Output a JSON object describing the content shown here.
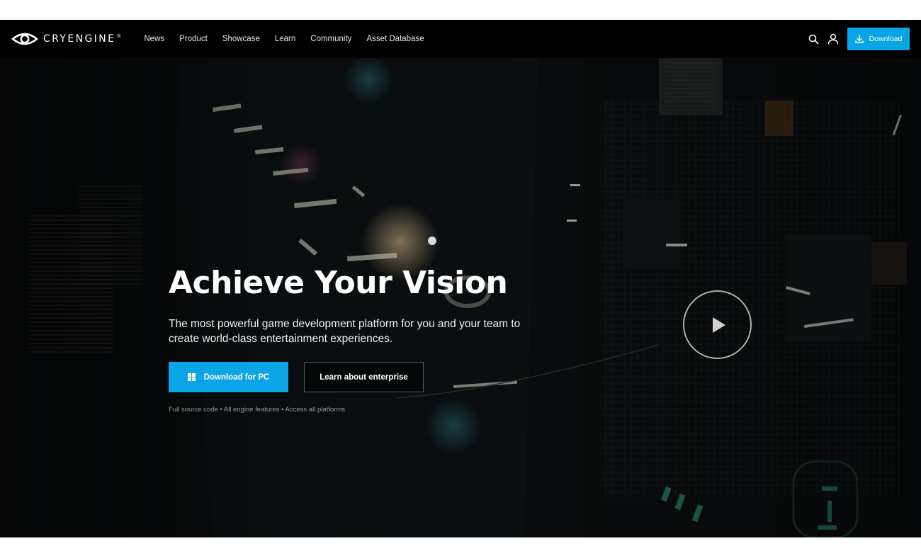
{
  "brand": {
    "name": "CRYENGINE",
    "registered_mark": "®"
  },
  "nav": {
    "links": [
      "News",
      "Product",
      "Showcase",
      "Learn",
      "Community",
      "Asset Database"
    ],
    "download_label": "Download"
  },
  "hero": {
    "title": "Achieve Your Vision",
    "subtitle": "The most powerful game development platform for you and your team to create world-class entertainment experiences.",
    "primary_button": "Download for PC",
    "secondary_button": "Learn about enterprise",
    "note": "Full source code • All engine features • Access all platforms"
  },
  "icons": {
    "logo": "eye-logo-icon",
    "search": "search-icon",
    "account": "user-icon",
    "download": "download-icon",
    "windows": "windows-icon",
    "play": "play-icon"
  },
  "colors": {
    "accent": "#0aa5e6",
    "navbar": "#000000",
    "hero_bg": "#050607"
  }
}
